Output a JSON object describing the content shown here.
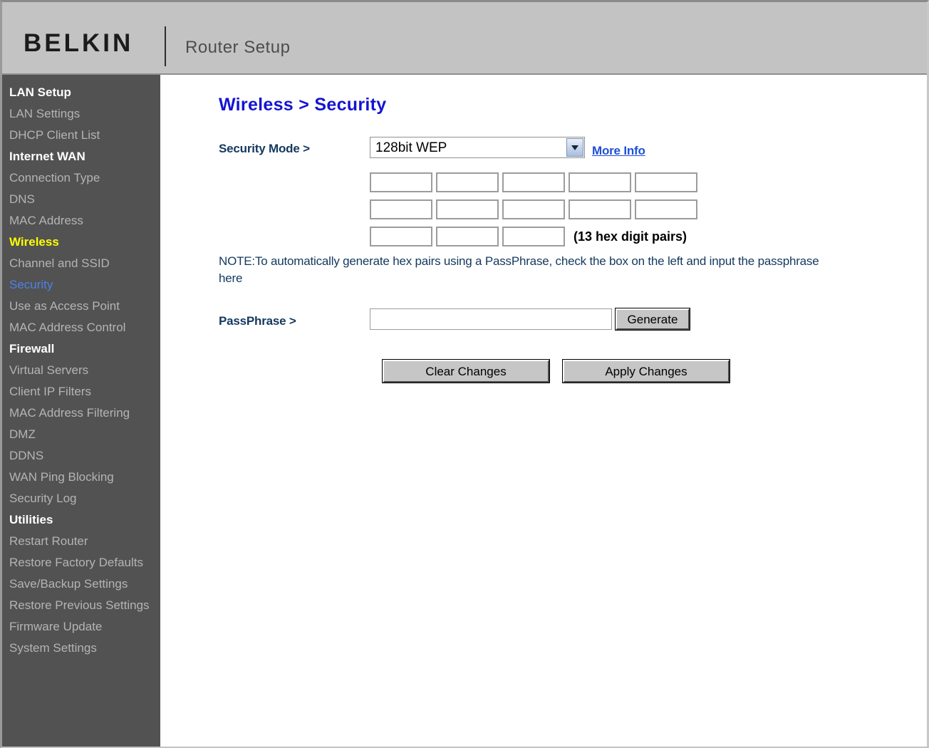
{
  "header": {
    "brand": "BELKIN",
    "title": "Router Setup"
  },
  "sidebar": {
    "items": [
      {
        "label": "LAN Setup",
        "style": "group"
      },
      {
        "label": "LAN Settings",
        "style": "link"
      },
      {
        "label": "DHCP Client List",
        "style": "link"
      },
      {
        "label": "Internet WAN",
        "style": "group"
      },
      {
        "label": "Connection Type",
        "style": "link"
      },
      {
        "label": "DNS",
        "style": "link"
      },
      {
        "label": "MAC Address",
        "style": "link"
      },
      {
        "label": "Wireless",
        "style": "highlight"
      },
      {
        "label": "Channel and SSID",
        "style": "link"
      },
      {
        "label": "Security",
        "style": "active"
      },
      {
        "label": "Use as Access Point",
        "style": "link"
      },
      {
        "label": "MAC Address Control",
        "style": "link"
      },
      {
        "label": "Firewall",
        "style": "group"
      },
      {
        "label": "Virtual Servers",
        "style": "link"
      },
      {
        "label": "Client IP Filters",
        "style": "link"
      },
      {
        "label": "MAC Address Filtering",
        "style": "link"
      },
      {
        "label": "DMZ",
        "style": "link"
      },
      {
        "label": "DDNS",
        "style": "link"
      },
      {
        "label": "WAN Ping Blocking",
        "style": "link"
      },
      {
        "label": "Security Log",
        "style": "link"
      },
      {
        "label": "Utilities",
        "style": "group"
      },
      {
        "label": "Restart Router",
        "style": "link"
      },
      {
        "label": "Restore Factory Defaults",
        "style": "link"
      },
      {
        "label": "Save/Backup Settings",
        "style": "link"
      },
      {
        "label": "Restore Previous Settings",
        "style": "link"
      },
      {
        "label": "Firmware Update",
        "style": "link"
      },
      {
        "label": "System Settings",
        "style": "link"
      }
    ]
  },
  "main": {
    "heading": "Wireless > Security",
    "security_mode": {
      "label": "Security Mode >",
      "value": "128bit WEP",
      "more_info": "More Info"
    },
    "hex_keys": {
      "rows": [
        [
          "",
          "",
          "",
          "",
          ""
        ],
        [
          "",
          "",
          "",
          "",
          ""
        ],
        [
          "",
          "",
          ""
        ]
      ],
      "hint": "(13 hex digit pairs)"
    },
    "note": "NOTE:To automatically generate hex pairs using a PassPhrase, check the box on the left and input the passphrase here",
    "passphrase": {
      "label": "PassPhrase >",
      "value": "",
      "placeholder": "",
      "generate_label": "Generate"
    },
    "buttons": {
      "clear": "Clear Changes",
      "apply": "Apply Changes"
    }
  },
  "colors": {
    "heading_blue": "#1414d2",
    "link_blue": "#1f4fd8",
    "active_nav": "#4d81e8",
    "highlight_yellow": "#ffff00",
    "sidebar_bg": "#525252",
    "header_bg": "#c3c3c3"
  }
}
